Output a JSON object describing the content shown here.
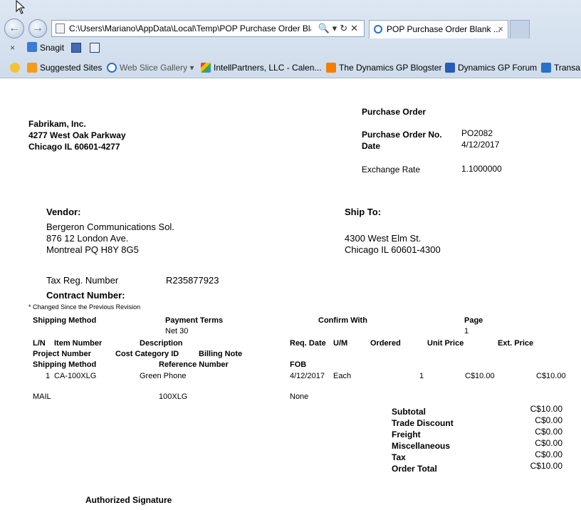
{
  "browser": {
    "address": "C:\\Users\\Mariano\\AppData\\Local\\Temp\\POP Purchase Order Bla",
    "tab_title": "POP Purchase Order Blank ...",
    "close_glyph": "×",
    "toolbar": {
      "close_glyph": "×",
      "snagit_label": "Snagit"
    },
    "favorites": [
      {
        "label": "Suggested Sites",
        "icon": "suggested-sites-icon",
        "color": "#f49b1a"
      },
      {
        "label": "Web Slice Gallery ▾",
        "icon": "web-slice-icon",
        "color": "#2a6fc9"
      },
      {
        "label": "IntellPartners, LLC - Calen...",
        "icon": "google-icon",
        "color": "#34a853"
      },
      {
        "label": "The Dynamics GP Blogster",
        "icon": "blogger-icon",
        "color": "#f57d00"
      },
      {
        "label": "Dynamics GP Forum",
        "icon": "forum-icon",
        "color": "#2a5bb8"
      },
      {
        "label": "Transa",
        "icon": "transaction-icon",
        "color": "#2a6fc9"
      }
    ]
  },
  "document": {
    "company": {
      "name": "Fabrikam, Inc.",
      "address1": "4277 West Oak Parkway",
      "address2": "Chicago IL 60601-4277"
    },
    "title": "Purchase Order",
    "po_no_label": "Purchase Order No.",
    "po_no": "PO2082",
    "date_label": "Date",
    "date": "4/12/2017",
    "exchange_label": "Exchange Rate",
    "exchange_rate": "1.1000000",
    "vendor_label": "Vendor:",
    "vendor": {
      "name": "Bergeron Communications Sol.",
      "address1": "876 12 London Ave.",
      "address2": "Montreal PQ H8Y 8G5"
    },
    "shipto_label": "Ship To:",
    "shipto": {
      "address1": "4300 West Elm St.",
      "address2": "Chicago IL 60601-4300"
    },
    "tax_label": "Tax Reg. Number",
    "tax_number": "R235877923",
    "contract_label": "Contract Number:",
    "changed_note": "* Changed Since the Previous Revision",
    "headers": {
      "shipping_method": "Shipping Method",
      "payment_terms": "Payment Terms",
      "confirm_with": "Confirm With",
      "page": "Page",
      "ln": "L/N",
      "item_number": "Item Number",
      "description": "Description",
      "req_date": "Req. Date",
      "um": "U/M",
      "ordered": "Ordered",
      "unit_price": "Unit Price",
      "ext_price": "Ext. Price",
      "project_number": "Project Number",
      "cost_category": "Cost Category ID",
      "billing_note": "Billing Note",
      "shipping_method2": "Shipping Method",
      "reference_number": "Reference Number",
      "fob": "FOB"
    },
    "header_values": {
      "payment_terms": "Net 30",
      "page": "1"
    },
    "line": {
      "ln": "1",
      "item": "CA-100XLG",
      "description": "Green Phone",
      "req_date": "4/12/2017",
      "um": "Each",
      "ordered": "1",
      "unit_price": "C$10.00",
      "ext_price": "C$10.00",
      "shipping_method": "MAIL",
      "reference": "100XLG",
      "fob": "None"
    },
    "totals": [
      {
        "label": "Subtotal",
        "value": "C$10.00"
      },
      {
        "label": "Trade Discount",
        "value": "C$0.00"
      },
      {
        "label": "Freight",
        "value": "C$0.00"
      },
      {
        "label": "Miscellaneous",
        "value": "C$0.00"
      },
      {
        "label": "Tax",
        "value": "C$0.00"
      },
      {
        "label": "Order Total",
        "value": "C$10.00"
      }
    ],
    "signature_label": "Authorized Signature"
  }
}
